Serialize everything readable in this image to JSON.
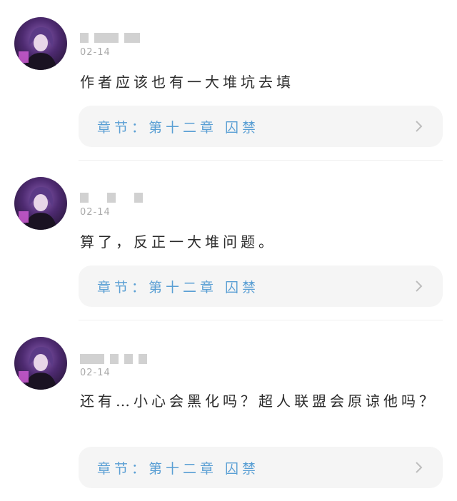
{
  "comments": [
    {
      "date": "02-14",
      "text": "作者应该也有一大堆坑去填",
      "chapter_label": "章节：第十二章 囚禁"
    },
    {
      "date": "02-14",
      "text": "算了，反正一大堆问题。",
      "chapter_label": "章节：第十二章 囚禁"
    },
    {
      "date": "02-14",
      "text": "还有…小心会黑化吗？超人联盟会原谅他吗？",
      "chapter_label": "章节：第十二章 囚禁"
    }
  ],
  "icons": {
    "avatar": "avatar-image",
    "chapter_arrow": "chevron-right-icon"
  },
  "colors": {
    "chapter_text": "#5a9fd4",
    "chapter_bg": "#f5f5f5",
    "date": "#a9a9a9"
  }
}
